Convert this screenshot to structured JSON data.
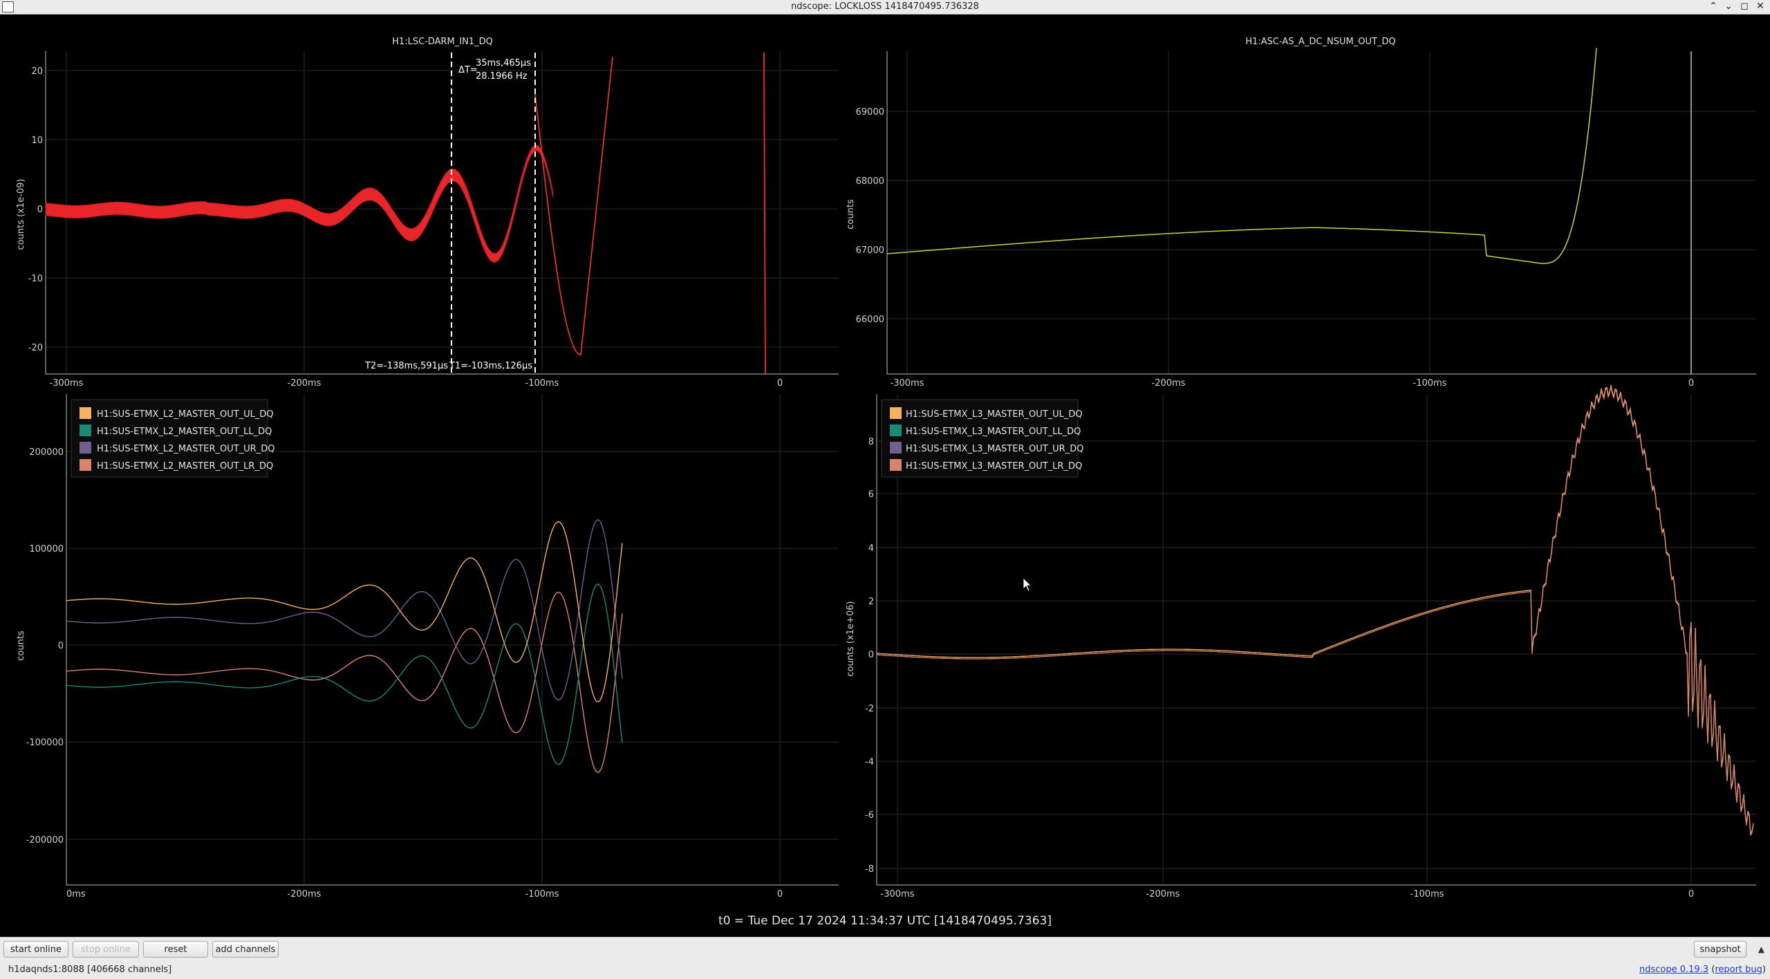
{
  "window": {
    "title": "ndscope: LOCKLOSS 1418470495.736328",
    "minimize_glyph": "⌃",
    "maximize_glyph": "⌄",
    "restore_glyph": "◻",
    "close_glyph": "✕"
  },
  "colors": {
    "background": "#000000",
    "grid": "#2c2c2c",
    "axis": "#bfbfbf",
    "darm": "#e8262a",
    "ascdc": "#d0d04a",
    "UL": "#f5b25f",
    "LL": "#1a8a78",
    "UR": "#6f6090",
    "LR": "#d9856d",
    "cursor": "#ffffff"
  },
  "plots": [
    {
      "id": "darm",
      "title": "H1:LSC-DARM_IN1_DQ",
      "ylabel": "counts (x1e-09)",
      "xticks": [
        "-300ms",
        "-200ms",
        "-100ms",
        "0"
      ],
      "yticks": [
        "20",
        "10",
        "0",
        "-10",
        "-20"
      ]
    },
    {
      "id": "asc",
      "title": "H1:ASC-AS_A_DC_NSUM_OUT_DQ",
      "ylabel": "counts",
      "xticks": [
        "-300ms",
        "-200ms",
        "-100ms",
        "0"
      ],
      "yticks": [
        "69000",
        "68000",
        "67000",
        "66000"
      ]
    },
    {
      "id": "l2",
      "title": "",
      "ylabel": "counts",
      "xticks": [
        "0ms",
        "-200ms",
        "-100ms",
        "0"
      ],
      "yticks": [
        "200000",
        "100000",
        "0",
        "-100000",
        "-200000"
      ],
      "legend": [
        "H1:SUS-ETMX_L2_MASTER_OUT_UL_DQ",
        "H1:SUS-ETMX_L2_MASTER_OUT_LL_DQ",
        "H1:SUS-ETMX_L2_MASTER_OUT_UR_DQ",
        "H1:SUS-ETMX_L2_MASTER_OUT_LR_DQ"
      ]
    },
    {
      "id": "l3",
      "title": "",
      "ylabel": "counts (x1e+06)",
      "xticks": [
        "-300ms",
        "-200ms",
        "-100ms",
        "0"
      ],
      "yticks": [
        "8",
        "6",
        "4",
        "2",
        "0",
        "-2",
        "-4",
        "-6",
        "-8"
      ],
      "legend": [
        "H1:SUS-ETMX_L3_MASTER_OUT_UL_DQ",
        "H1:SUS-ETMX_L3_MASTER_OUT_LL_DQ",
        "H1:SUS-ETMX_L3_MASTER_OUT_UR_DQ",
        "H1:SUS-ETMX_L3_MASTER_OUT_LR_DQ"
      ]
    }
  ],
  "cursors": {
    "delta_label": "ΔT=",
    "delta_time": "35ms,465μs",
    "delta_freq": "28.1966 Hz",
    "t2_label": "T2=-138ms,591μs",
    "t1_label": "T1=-103ms,126μs"
  },
  "t0_label": "t0 = Tue Dec 17 2024 11:34:37 UTC [1418470495.7363]",
  "buttons": {
    "start_online": "start online",
    "stop_online": "stop online",
    "reset": "reset",
    "add_channels": "add channels",
    "snapshot": "snapshot"
  },
  "status": {
    "server": "h1daqnds1:8088",
    "channels": "[406668 channels]",
    "version_link": "ndscope 0.19.3",
    "report_prefix": "(",
    "report_link": "report bug",
    "report_suffix": ")"
  }
}
